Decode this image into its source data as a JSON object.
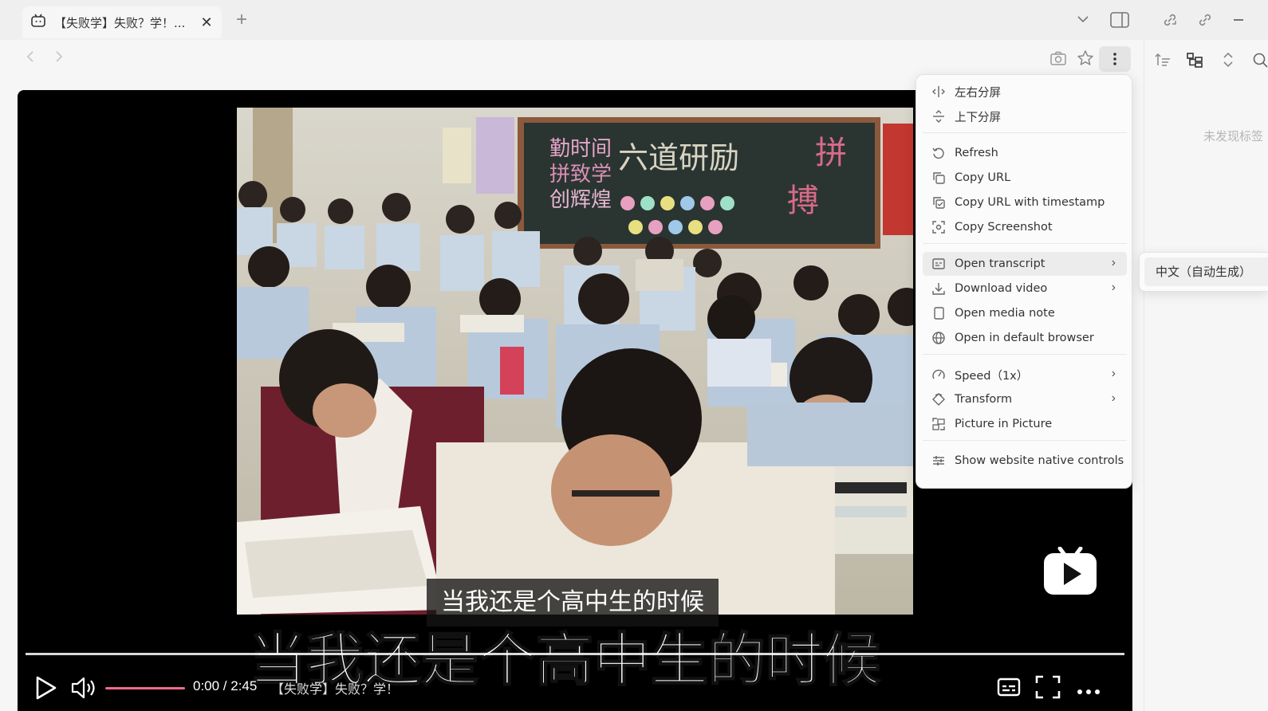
{
  "tab": {
    "title": "【失败学】失败？学！...",
    "close_icon": "close-icon",
    "new_tab_label": "+"
  },
  "nav": {
    "back_icon": "arrow-left-icon",
    "forward_icon": "arrow-right-icon"
  },
  "right_panel": {
    "empty_text": "未发现标签"
  },
  "video": {
    "subtitle_small": "当我还是个高中生的时候",
    "subtitle_large": "当我还是个高中生的时候",
    "time": "0:00 / 2:45",
    "title_overlay": "【失败学】失败？学！",
    "progress": 0
  },
  "menu": {
    "items": [
      {
        "label": "左右分屏",
        "icon": "split-horizontal-icon"
      },
      {
        "label": "上下分屏",
        "icon": "split-vertical-icon"
      },
      {
        "label": "Refresh",
        "icon": "refresh-icon"
      },
      {
        "label": "Copy URL",
        "icon": "copy-icon"
      },
      {
        "label": "Copy URL with timestamp",
        "icon": "copy-timestamp-icon"
      },
      {
        "label": "Copy Screenshot",
        "icon": "screenshot-icon"
      },
      {
        "label": "Open transcript",
        "icon": "transcript-icon"
      },
      {
        "label": "Download video",
        "icon": "download-icon"
      },
      {
        "label": "Open media note",
        "icon": "note-icon"
      },
      {
        "label": "Open in default browser",
        "icon": "globe-icon"
      },
      {
        "label": "Speed（1x）",
        "icon": "speed-icon"
      },
      {
        "label": "Transform",
        "icon": "transform-icon"
      },
      {
        "label": "Picture in Picture",
        "icon": "pip-icon"
      },
      {
        "label": "Show website native controls",
        "icon": "sliders-icon"
      }
    ],
    "submenu_item": "中文（自动生成）"
  },
  "colors": {
    "accent": "#f06b8a",
    "menu_bg": "#fbfbfb",
    "video_bg": "#000000"
  }
}
